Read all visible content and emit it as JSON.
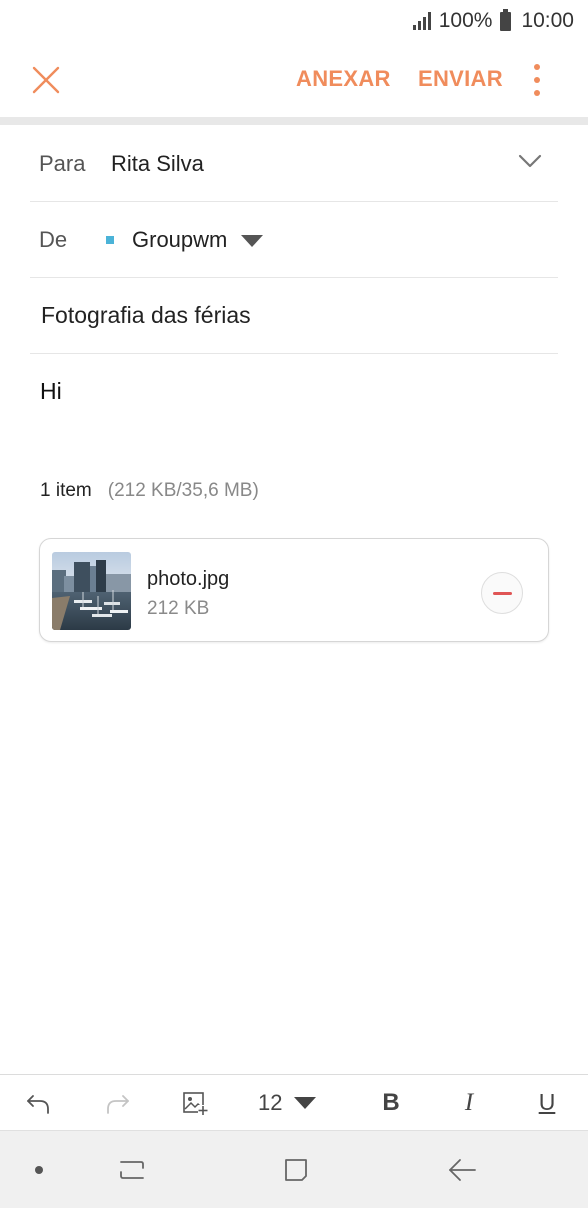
{
  "status_bar": {
    "battery_text": "100%",
    "time": "10:00",
    "icons": [
      "signal-icon",
      "battery-icon"
    ]
  },
  "app_bar": {
    "close_icon": "close-icon",
    "attach_label": "ANEXAR",
    "send_label": "ENVIAR",
    "more_icon": "more-vert-icon"
  },
  "compose": {
    "to_label": "Para",
    "to_value": "Rita Silva",
    "from_label": "De",
    "from_value": "Groupwm",
    "subject": "Fotografia das férias",
    "body": "Hi"
  },
  "attachments": {
    "count_label": "1 item",
    "size_label": "(212 KB/35,6 MB)",
    "items": [
      {
        "name": "photo.jpg",
        "size": "212 KB"
      }
    ]
  },
  "format_toolbar": {
    "font_size": "12",
    "bold_label": "B",
    "italic_label": "I",
    "underline_label": "U",
    "icons": [
      "undo-icon",
      "redo-icon",
      "insert-image-icon"
    ]
  },
  "nav_bar": {
    "icons": [
      "nav-dot-icon",
      "recents-icon",
      "home-icon",
      "back-icon"
    ]
  },
  "colors": {
    "accent": "#f08c5c",
    "account_marker": "#4bb3d8",
    "remove_red": "#e05555"
  }
}
